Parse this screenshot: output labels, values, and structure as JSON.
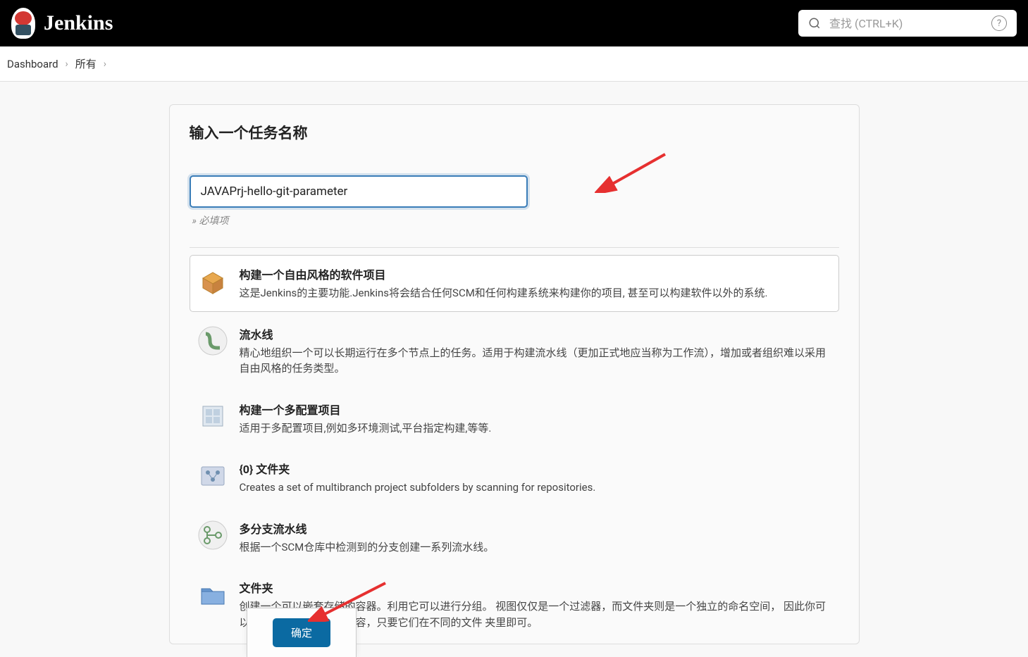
{
  "header": {
    "title": "Jenkins",
    "search_placeholder": "查找 (CTRL+K)"
  },
  "breadcrumb": {
    "items": [
      "Dashboard",
      "所有"
    ]
  },
  "form": {
    "title": "输入一个任务名称",
    "name_value": "JAVAPrj-hello-git-parameter",
    "required_hint": "» 必填项"
  },
  "item_types": [
    {
      "title": "构建一个自由风格的软件项目",
      "desc": "这是Jenkins的主要功能.Jenkins将会结合任何SCM和任何构建系统来构建你的项目, 甚至可以构建软件以外的系统.",
      "selected": true
    },
    {
      "title": "流水线",
      "desc": "精心地组织一个可以长期运行在多个节点上的任务。适用于构建流水线（更加正式地应当称为工作流），增加或者组织难以采用自由风格的任务类型。",
      "selected": false
    },
    {
      "title": "构建一个多配置项目",
      "desc": "适用于多配置项目,例如多环境测试,平台指定构建,等等.",
      "selected": false
    },
    {
      "title": "{0} 文件夹",
      "desc": "Creates a set of multibranch project subfolders by scanning for repositories.",
      "selected": false
    },
    {
      "title": "多分支流水线",
      "desc": "根据一个SCM仓库中检测到的分支创建一系列流水线。",
      "selected": false
    },
    {
      "title": "文件夹",
      "desc": "创建一个可以嵌套存储的容器。利用它可以进行分组。 视图仅仅是一个过滤器，而文件夹则是一个独立的命名空间， 因此你可以有多个相同名称的的内容，只要它们在不同的文件 夹里即可。",
      "selected": false
    }
  ],
  "footer": {
    "ok_label": "确定"
  }
}
